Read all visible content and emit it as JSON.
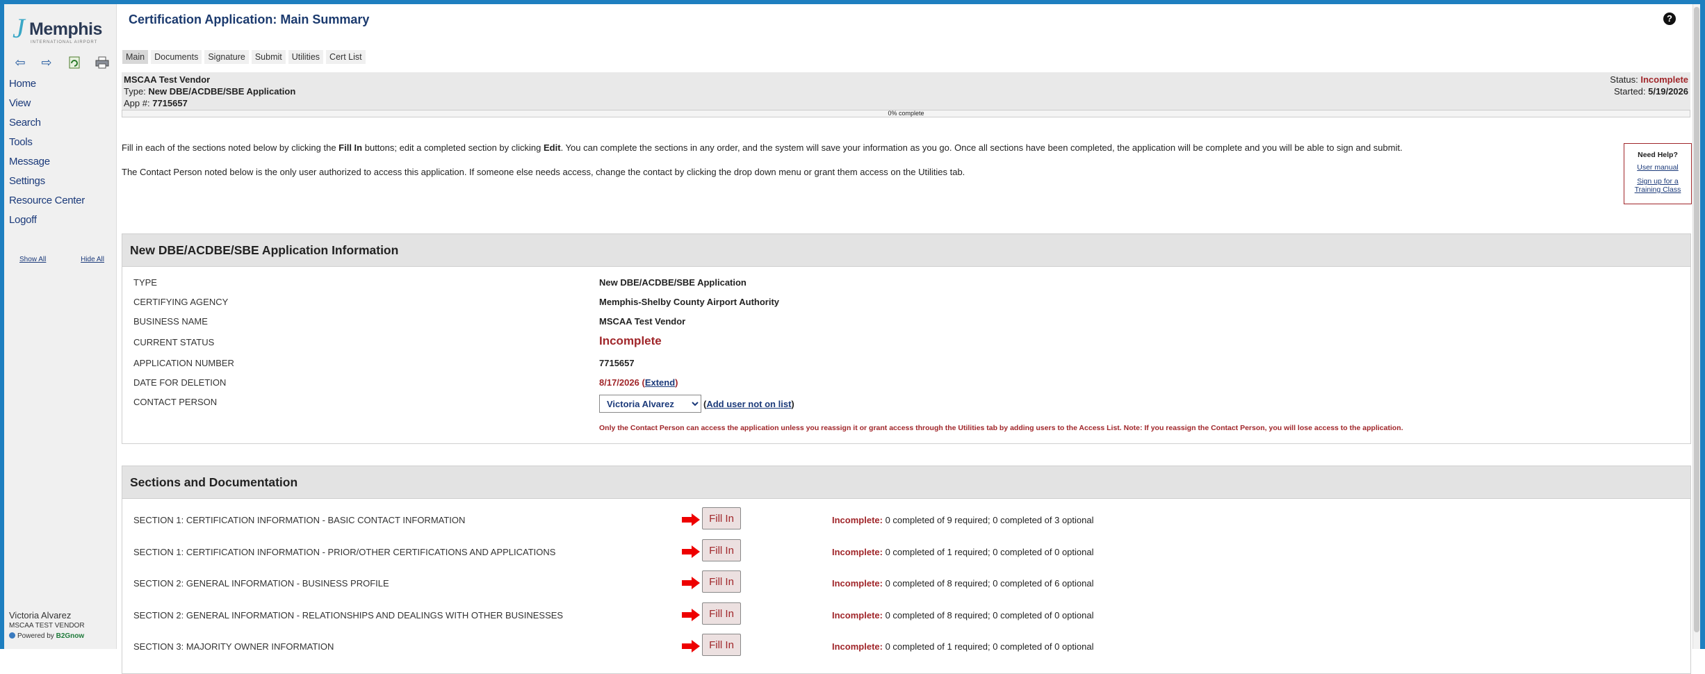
{
  "sidebar": {
    "logo_text": "Memphis",
    "logo_sub": "INTERNATIONAL AIRPORT",
    "toolbar_icons": [
      "arrow-left-icon",
      "arrow-right-icon",
      "refresh-icon",
      "print-icon"
    ],
    "nav": [
      "Home",
      "View",
      "Search",
      "Tools",
      "Message",
      "Settings",
      "Resource Center",
      "Logoff"
    ],
    "show_all": "Show All",
    "hide_all": "Hide All",
    "user_name": "Victoria Alvarez",
    "user_org": "MSCAA TEST VENDOR",
    "powered_prefix": "Powered by",
    "powered_brand": "B2Gnow"
  },
  "header": {
    "title": "Certification Application: Main Summary",
    "help_symbol": "?"
  },
  "tabs": [
    "Main",
    "Documents",
    "Signature",
    "Submit",
    "Utilities",
    "Cert List"
  ],
  "app_info": {
    "vendor": "MSCAA Test Vendor",
    "type_label": "Type:",
    "type_value": "New DBE/ACDBE/SBE Application",
    "app_num_label": "App #:",
    "app_num_value": "7715657",
    "status_label": "Status:",
    "status_value": "Incomplete",
    "started_label": "Started:",
    "started_value": "5/19/2026",
    "progress_percent": 0,
    "progress_text": "0% complete"
  },
  "intro": {
    "p1_a": "Fill in each of the sections noted below by clicking the ",
    "p1_b": "Fill In",
    "p1_c": " buttons; edit a completed section by clicking ",
    "p1_d": "Edit",
    "p1_e": ". You can complete the sections in any order, and the system will save your information as you go. Once all sections have been completed, the application will be complete and you will be able to sign and submit.",
    "p2": "The Contact Person noted below is the only user authorized to access this application. If someone else needs access, change the contact by clicking the drop down menu or grant them access on the Utilities tab."
  },
  "help_box": {
    "title": "Need Help?",
    "manual": "User manual",
    "training_1": "Sign up for a",
    "training_2": "Training Class"
  },
  "info_panel": {
    "title": "New DBE/ACDBE/SBE Application Information",
    "type_label": "TYPE",
    "type_value": "New DBE/ACDBE/SBE Application",
    "agency_label": "CERTIFYING AGENCY",
    "agency_value": "Memphis-Shelby County Airport Authority",
    "business_label": "BUSINESS NAME",
    "business_value": "MSCAA Test Vendor",
    "status_label": "CURRENT STATUS",
    "status_value": "Incomplete",
    "appnum_label": "APPLICATION NUMBER",
    "appnum_value": "7715657",
    "deletion_label": "DATE FOR DELETION",
    "deletion_value": "8/17/2026",
    "extend_label": "Extend",
    "contact_label": "CONTACT PERSON",
    "contact_selected": "Victoria Alvarez",
    "add_user_label": "Add user not on list",
    "contact_note": "Only the Contact Person can access the application unless you reassign it or grant access through the Utilities tab by adding users to the Access List. Note: If you reassign the Contact Person, you will lose access to the application."
  },
  "sections_panel": {
    "title": "Sections and Documentation",
    "button_label": "Fill In",
    "status_label": "Incomplete:",
    "rows": [
      {
        "label": "SECTION 1: CERTIFICATION INFORMATION - BASIC CONTACT INFORMATION",
        "status": " 0 completed of 9 required; 0 completed of 3 optional"
      },
      {
        "label": "SECTION 1: CERTIFICATION INFORMATION - PRIOR/OTHER CERTIFICATIONS AND APPLICATIONS",
        "status": " 0 completed of 1 required; 0 completed of 0 optional"
      },
      {
        "label": "SECTION 2: GENERAL INFORMATION - BUSINESS PROFILE",
        "status": " 0 completed of 8 required; 0 completed of 6 optional"
      },
      {
        "label": "SECTION 2: GENERAL INFORMATION - RELATIONSHIPS AND DEALINGS WITH OTHER BUSINESSES",
        "status": " 0 completed of 8 required; 0 completed of 0 optional"
      },
      {
        "label": "SECTION 3: MAJORITY OWNER INFORMATION",
        "status": " 0 completed of 1 required; 0 completed of 0 optional"
      }
    ]
  },
  "colors": {
    "frame": "#1e7fc0",
    "accent_red": "#a0262a",
    "link_blue": "#1b3a7a"
  }
}
